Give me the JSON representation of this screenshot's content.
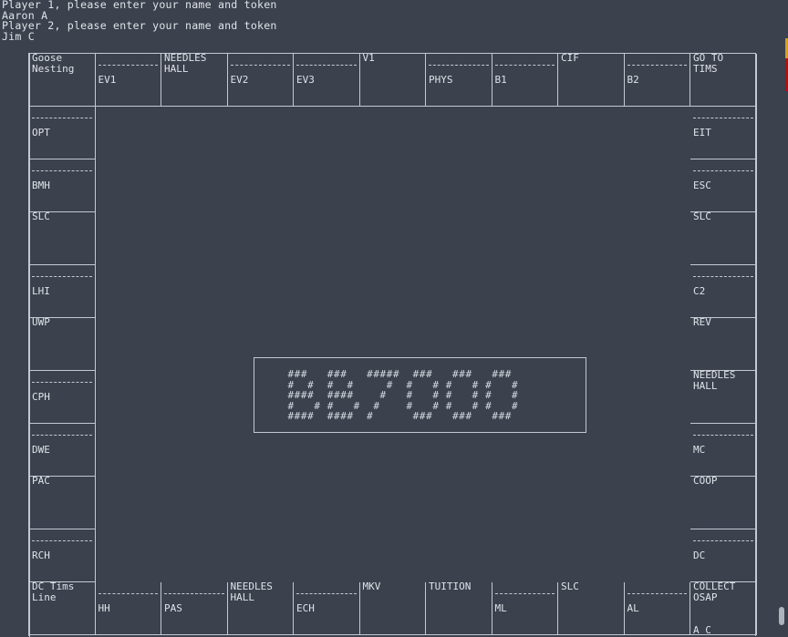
{
  "terminal": {
    "lines": [
      "Player 1, please enter your name and token",
      "Aaron A",
      "Player 2, please enter your name and token",
      "Jim C"
    ]
  },
  "board": {
    "top_row": [
      {
        "name": "Goose Nesting",
        "l1": "Goose",
        "l2": "Nesting",
        "improvable": false
      },
      {
        "name": "EV1",
        "improvable": true
      },
      {
        "name": "NEEDLES HALL",
        "l1": "NEEDLES",
        "l2": "HALL",
        "improvable": false
      },
      {
        "name": "EV2",
        "improvable": true
      },
      {
        "name": "EV3",
        "improvable": true
      },
      {
        "name": "V1",
        "improvable": false
      },
      {
        "name": "PHYS",
        "improvable": true
      },
      {
        "name": "B1",
        "improvable": true
      },
      {
        "name": "CIF",
        "improvable": false
      },
      {
        "name": "B2",
        "improvable": true
      },
      {
        "name": "GO TO TIMS",
        "l1": "GO TO",
        "l2": "TIMS",
        "improvable": false
      }
    ],
    "left_column": [
      {
        "name": "OPT",
        "improvable": true
      },
      {
        "name": "BMH",
        "improvable": true
      },
      {
        "name": "SLC",
        "improvable": false
      },
      {
        "name": "LHI",
        "improvable": true
      },
      {
        "name": "UWP",
        "improvable": false
      },
      {
        "name": "CPH",
        "improvable": true
      },
      {
        "name": "DWE",
        "improvable": true
      },
      {
        "name": "PAC",
        "improvable": false
      },
      {
        "name": "RCH",
        "improvable": true
      }
    ],
    "right_column": [
      {
        "name": "EIT",
        "improvable": true
      },
      {
        "name": "ESC",
        "improvable": true
      },
      {
        "name": "SLC",
        "improvable": false
      },
      {
        "name": "C2",
        "improvable": true
      },
      {
        "name": "REV",
        "improvable": false
      },
      {
        "name": "NEEDLES HALL",
        "l1": "NEEDLES",
        "l2": "HALL",
        "improvable": false
      },
      {
        "name": "MC",
        "improvable": true
      },
      {
        "name": "COOP",
        "improvable": false
      },
      {
        "name": "DC",
        "improvable": true
      }
    ],
    "bottom_row": [
      {
        "name": "DC Tims Line",
        "l1": "DC Tims",
        "l2": "Line",
        "improvable": false
      },
      {
        "name": "HH",
        "improvable": true
      },
      {
        "name": "PAS",
        "improvable": true
      },
      {
        "name": "NEEDLES HALL",
        "l1": "NEEDLES",
        "l2": "HALL",
        "improvable": false
      },
      {
        "name": "ECH",
        "improvable": true
      },
      {
        "name": "MKV",
        "improvable": false
      },
      {
        "name": "TUITION",
        "improvable": false
      },
      {
        "name": "ML",
        "improvable": true
      },
      {
        "name": "SLC",
        "improvable": false
      },
      {
        "name": "AL",
        "improvable": true
      },
      {
        "name": "COLLECT OSAP",
        "l1": "COLLECT",
        "l2": "OSAP",
        "improvable": false,
        "occupants": "A C"
      }
    ],
    "logo_art": [
      "  ###   ###   #####  ###   ###   ###",
      "  #  #  #  #     #  #   # #   # #   #",
      "  ####  ####    #   #   # #   # #   #",
      "  #   # #   #  #    #   # #   # #   #",
      "  ####  ####  #      ###   ###   ###"
    ]
  },
  "colors": {
    "background": "#3b414d",
    "text": "#e0e3e8",
    "lines": "#c4c9d2"
  }
}
